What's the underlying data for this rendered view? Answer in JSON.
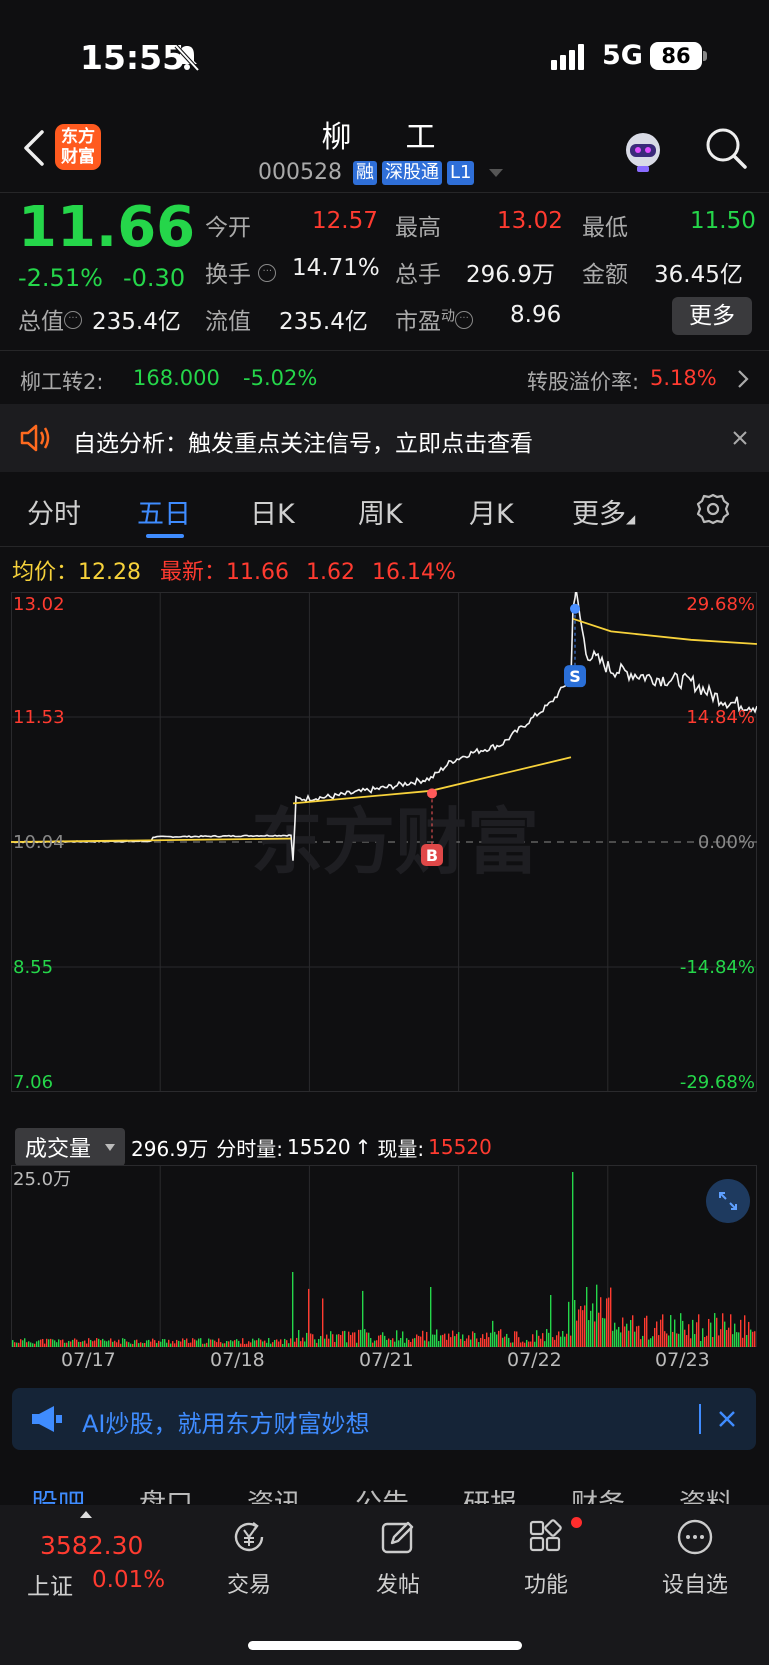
{
  "status": {
    "time": "15:55",
    "network": "5G",
    "battery": "86"
  },
  "header": {
    "logo": "东方财富",
    "name": "柳　工",
    "code": "000528",
    "tags": [
      "融",
      "深股通",
      "L1"
    ]
  },
  "quote": {
    "price": "11.66",
    "change_pct": "-2.51%",
    "change": "-0.30",
    "stats": [
      {
        "label": "今开",
        "value": "12.57"
      },
      {
        "label": "最高",
        "value": "13.02"
      },
      {
        "label": "最低",
        "value": "11.50"
      },
      {
        "label": "换手",
        "value": "14.71%"
      },
      {
        "label": "总手",
        "value": "296.9万"
      },
      {
        "label": "金额",
        "value": "36.45亿"
      },
      {
        "label": "总值",
        "value": "235.4亿"
      },
      {
        "label": "流值",
        "value": "235.4亿"
      },
      {
        "label": "市盈",
        "value": "8.96"
      }
    ],
    "pe_sup": "动",
    "more_button": "更多"
  },
  "convertible": {
    "name": "柳工转2:",
    "price": "168.000",
    "change": "-5.02%",
    "premium_label": "转股溢价率:",
    "premium_value": "5.18%"
  },
  "notice": {
    "text": "自选分析：触发重点关注信号，立即点击查看"
  },
  "tabs": [
    "分时",
    "五日",
    "日K",
    "周K",
    "月K",
    "更多"
  ],
  "active_tab": "五日",
  "avg_row": {
    "avg_label": "均价：",
    "avg_value": "12.28",
    "latest_label": "最新：",
    "latest_value": "11.66",
    "diff": "1.62",
    "diff_pct": "16.14%"
  },
  "chart_data": {
    "type": "line",
    "x_dates": [
      "07/17",
      "07/18",
      "07/21",
      "07/22",
      "07/23"
    ],
    "y_left_ticks": [
      "13.02",
      "11.53",
      "10.04",
      "8.55",
      "7.06"
    ],
    "y_right_ticks": [
      "29.68%",
      "14.84%",
      "0.00%",
      "-14.84%",
      "-29.68%"
    ],
    "ylim": [
      7.06,
      13.02
    ],
    "base_price": 10.04,
    "watermark": "东方财富",
    "series": [
      {
        "values_daily_close_approx": [
          10.04,
          10.1,
          10.6,
          11.6,
          11.66
        ]
      }
    ],
    "markers": [
      {
        "label": "B",
        "date": "07/21"
      },
      {
        "label": "S",
        "date": "07/22"
      }
    ]
  },
  "volume": {
    "selector": "成交量",
    "total": "296.9万",
    "minute_label": "分时量:",
    "minute_value": "15520",
    "arrow": "↑",
    "now_label": "现量:",
    "now_value": "15520",
    "max_label": "25.0万"
  },
  "ai_banner": {
    "text": "AI炒股，就用东方财富妙想"
  },
  "subtabs": [
    "股吧",
    "盘口",
    "资讯",
    "公告",
    "研报",
    "财务",
    "资料"
  ],
  "bottom_nav": {
    "index_value": "3582.30",
    "index_name": "上证",
    "index_change": "0.01%",
    "items": [
      "交易",
      "发帖",
      "功能",
      "设自选"
    ]
  }
}
